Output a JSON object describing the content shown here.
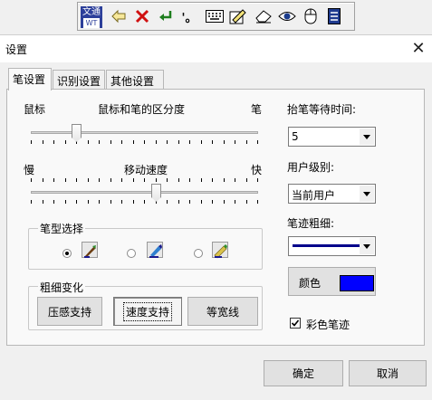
{
  "toolbar": {
    "logo_top": "文通",
    "logo_bottom": "WT",
    "icons": [
      "logo-icon",
      "arrow-left-icon",
      "delete-x-icon",
      "enter-icon",
      "punctuation-icon",
      "keyboard-icon",
      "handwrite-board-icon",
      "eraser-icon",
      "eye-icon",
      "mouse-icon",
      "settings-panel-icon"
    ],
    "punct_label": "'。"
  },
  "dialog": {
    "title": "设置",
    "close_glyph": "✕",
    "tabs": [
      "笔设置",
      "识别设置",
      "其他设置"
    ],
    "active_tab": 0,
    "distinction": {
      "left": "鼠标",
      "center": "鼠标和笔的区分度",
      "right": "笔",
      "level": 0.2
    },
    "speed": {
      "left": "慢",
      "center": "移动速度",
      "right": "快",
      "level": 0.55
    },
    "pen_type": {
      "label": "笔型选择",
      "options": [
        "pen-brush-icon",
        "pen-marker-icon",
        "pen-pencil-icon"
      ],
      "selected": 0
    },
    "thickness": {
      "label": "粗细变化",
      "buttons": [
        "压感支持",
        "速度支持",
        "等宽线"
      ],
      "pressed": 1
    },
    "wait_time": {
      "label": "抬笔等待时间:",
      "value": "5"
    },
    "user_level": {
      "label": "用户级别:",
      "value": "当前用户"
    },
    "stroke_width": {
      "label": "笔迹粗细:"
    },
    "color_button": {
      "label": "颜色",
      "swatch": "#0000ff"
    },
    "color_stroke": {
      "label": "彩色笔迹",
      "checked": true
    },
    "ok": "确定",
    "cancel": "取消"
  },
  "colors": {
    "accent": "#0000ff",
    "line": "#00008b"
  }
}
